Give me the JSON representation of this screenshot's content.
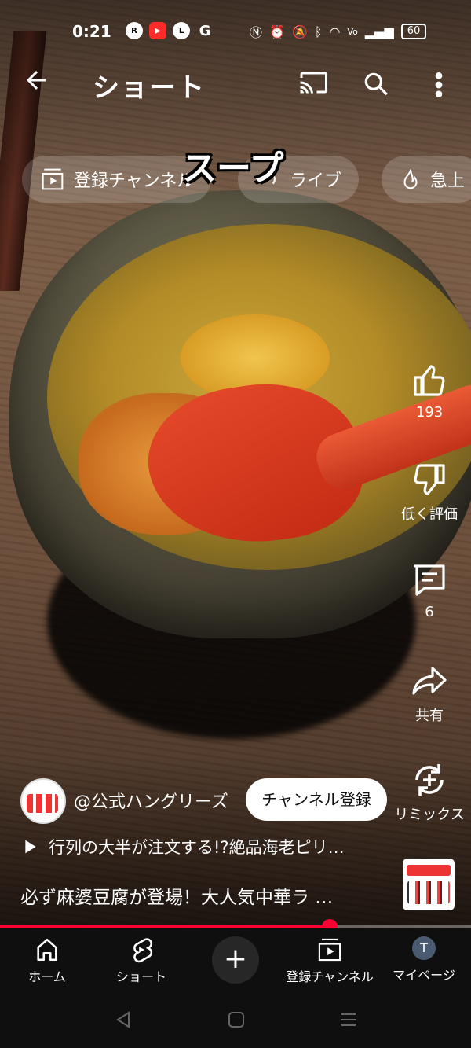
{
  "status_bar": {
    "time": "0:21",
    "left_icons": [
      "R Link",
      "YT",
      "LINE",
      "G"
    ],
    "battery": "60"
  },
  "app_bar": {
    "title": "ショート"
  },
  "video": {
    "overlay_text": "スープ"
  },
  "chips": [
    {
      "label": "登録チャンネル",
      "icon": "subscriptions-icon"
    },
    {
      "label": "ライブ",
      "icon": "live-icon"
    },
    {
      "label": "急上",
      "icon": "trending-icon"
    }
  ],
  "actions": {
    "like_count": "193",
    "dislike_label": "低く評価",
    "comment_count": "6",
    "share_label": "共有",
    "remix_label": "リミックス"
  },
  "channel": {
    "handle": "@公式ハングリーズ",
    "subscribe_label": "チャンネル登録"
  },
  "playlist_title": "行列の大半が注文する!?絶品海老ピリ…",
  "description": "必ず麻婆豆腐が登場！大人気中華ラ …",
  "progress": 0.7,
  "bottom_nav": {
    "home": "ホーム",
    "shorts": "ショート",
    "subscriptions": "登録チャンネル",
    "mypage": "マイページ",
    "avatar_letter": "T"
  },
  "colors": {
    "accent": "#ff0033",
    "nav_bg": "#0f0f0f"
  }
}
